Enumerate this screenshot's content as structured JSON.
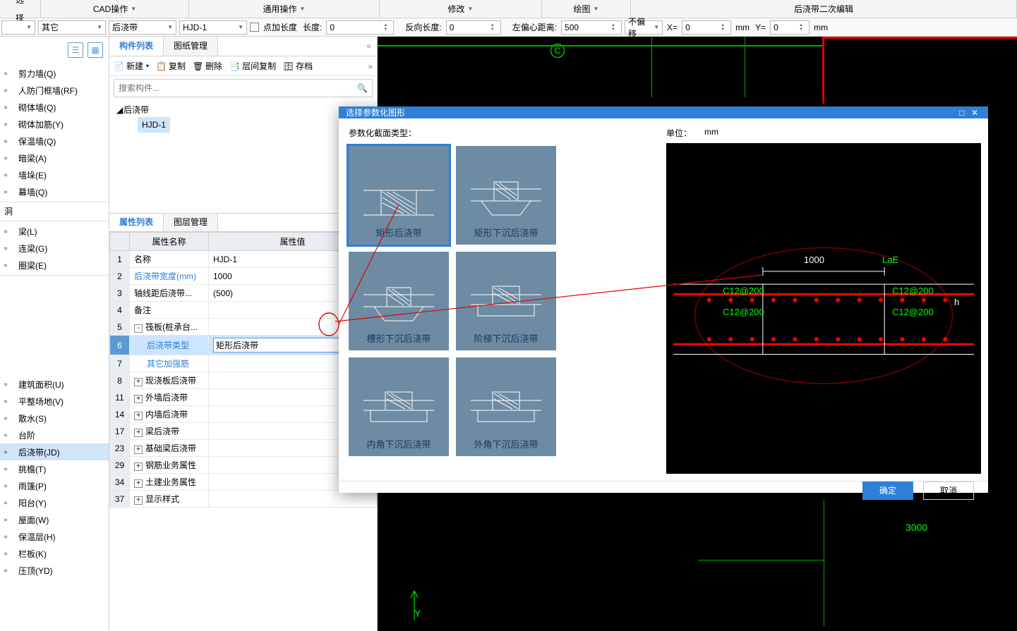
{
  "menu": {
    "select": "选择",
    "cad": "CAD操作",
    "general": "通用操作",
    "modify": "修改",
    "draw": "绘图",
    "secondary": "后浇带二次编辑"
  },
  "tb": {
    "dd1": "",
    "dd2": "其它",
    "dd3": "后浇带",
    "dd4": "HJD-1",
    "chk_label": "点加长度",
    "len_label": "长度:",
    "len_val": "0",
    "rev_label": "反向长度:",
    "rev_val": "0",
    "left_label": "左偏心距离:",
    "left_val": "500",
    "offset_dd": "不偏移",
    "x_label": "X=",
    "x_val": "0",
    "y_label": "Y=",
    "y_val": "0",
    "unit": "mm"
  },
  "sidebar": {
    "items_a": [
      {
        "label": "剪力墙(Q)"
      },
      {
        "label": "人防门框墙(RF)"
      },
      {
        "label": "砌体墙(Q)"
      },
      {
        "label": "砌体加筋(Y)"
      },
      {
        "label": "保温墙(Q)"
      },
      {
        "label": "暗梁(A)"
      },
      {
        "label": "墙垛(E)"
      },
      {
        "label": "幕墙(Q)"
      }
    ],
    "group_b": "洞",
    "items_b": [
      {
        "label": "梁(L)"
      },
      {
        "label": "连梁(G)"
      },
      {
        "label": "圈梁(E)"
      }
    ],
    "items_c": [
      {
        "label": "建筑面积(U)"
      },
      {
        "label": "平整场地(V)"
      },
      {
        "label": "散水(S)"
      },
      {
        "label": "台阶"
      },
      {
        "label": "后浇带(JD)",
        "active": true
      },
      {
        "label": "挑檐(T)"
      },
      {
        "label": "雨篷(P)"
      },
      {
        "label": "阳台(Y)"
      },
      {
        "label": "屋面(W)"
      },
      {
        "label": "保温层(H)"
      },
      {
        "label": "栏板(K)"
      },
      {
        "label": "压顶(YD)"
      }
    ]
  },
  "mid": {
    "tab1": "构件列表",
    "tab2": "图纸管理",
    "cmd_new": "新建",
    "cmd_copy": "复制",
    "cmd_del": "删除",
    "cmd_floorcopy": "层间复制",
    "cmd_archive": "存档",
    "search_ph": "搜索构件...",
    "tree_root": "后浇带",
    "tree_child": "HJD-1"
  },
  "prop": {
    "tab1": "属性列表",
    "tab2": "图层管理",
    "col_name": "属性名称",
    "col_val": "属性值",
    "rows": [
      {
        "n": "1",
        "name": "名称",
        "val": "HJD-1"
      },
      {
        "n": "2",
        "name": "后浇带宽度(mm)",
        "val": "1000",
        "link": true
      },
      {
        "n": "3",
        "name": "轴线距后浇带...",
        "val": "(500)"
      },
      {
        "n": "4",
        "name": "备注",
        "val": ""
      },
      {
        "n": "5",
        "name": "筏板(桩承台...",
        "val": "",
        "expand": "-"
      },
      {
        "n": "6",
        "name": "后浇带类型",
        "val": "矩形后浇带",
        "link": true,
        "selected": true,
        "edit": true,
        "indent": true
      },
      {
        "n": "7",
        "name": "其它加强筋",
        "val": "",
        "link": true,
        "indent": true
      },
      {
        "n": "8",
        "name": "现浇板后浇带",
        "val": "",
        "expand": "+"
      },
      {
        "n": "11",
        "name": "外墙后浇带",
        "val": "",
        "expand": "+"
      },
      {
        "n": "14",
        "name": "内墙后浇带",
        "val": "",
        "expand": "+"
      },
      {
        "n": "17",
        "name": "梁后浇带",
        "val": "",
        "expand": "+"
      },
      {
        "n": "23",
        "name": "基础梁后浇带",
        "val": "",
        "expand": "+"
      },
      {
        "n": "29",
        "name": "钢筋业务属性",
        "val": "",
        "expand": "+"
      },
      {
        "n": "34",
        "name": "土建业务属性",
        "val": "",
        "expand": "+"
      },
      {
        "n": "37",
        "name": "显示样式",
        "val": "",
        "expand": "+"
      }
    ]
  },
  "canvas": {
    "label_c": "C",
    "dim_bottom": "3000",
    "y_label": "Y"
  },
  "modal": {
    "title": "选择参数化图形",
    "section_label": "参数化截面类型：",
    "unit_label": "单位：",
    "unit_val": "mm",
    "thumbs": [
      {
        "cap": "矩形后浇带",
        "selected": true
      },
      {
        "cap": "矩形下沉后浇带"
      },
      {
        "cap": "槽形下沉后浇带"
      },
      {
        "cap": "阶梯下沉后浇带"
      },
      {
        "cap": "内角下沉后浇带"
      },
      {
        "cap": "外角下沉后浇带"
      }
    ],
    "preview": {
      "dim_top": "1000",
      "lae": "LaE",
      "rebar": "C12@200",
      "h": "h"
    },
    "ok": "确定",
    "cancel": "取消"
  }
}
